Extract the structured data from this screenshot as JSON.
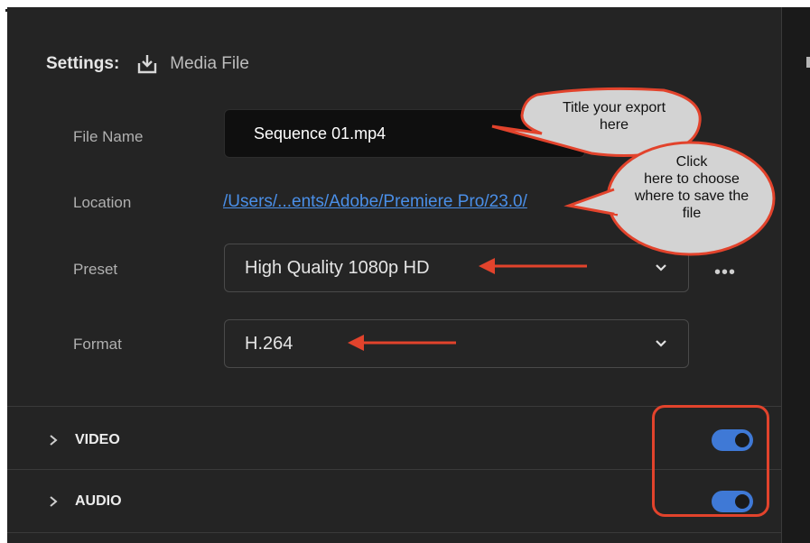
{
  "settings": {
    "label": "Settings:",
    "media_label": "Media File"
  },
  "file_name": {
    "label": "File Name",
    "value": "Sequence 01.mp4"
  },
  "location": {
    "label": "Location",
    "link": "/Users/...ents/Adobe/Premiere Pro/23.0/"
  },
  "preset": {
    "label": "Preset",
    "value": "High Quality 1080p HD",
    "more": "•••"
  },
  "format": {
    "label": "Format",
    "value": "H.264"
  },
  "sections": [
    {
      "label": "VIDEO",
      "enabled": true
    },
    {
      "label": "AUDIO",
      "enabled": true
    }
  ],
  "callouts": {
    "title": "Title your export\nhere",
    "location": "Click\nhere to choose\nwhere to save the\nfile"
  },
  "colors": {
    "accent": "#3f79d6",
    "link": "#4a8fe8",
    "annotation": "#e2432c",
    "bubble": "#d3d3d3"
  }
}
